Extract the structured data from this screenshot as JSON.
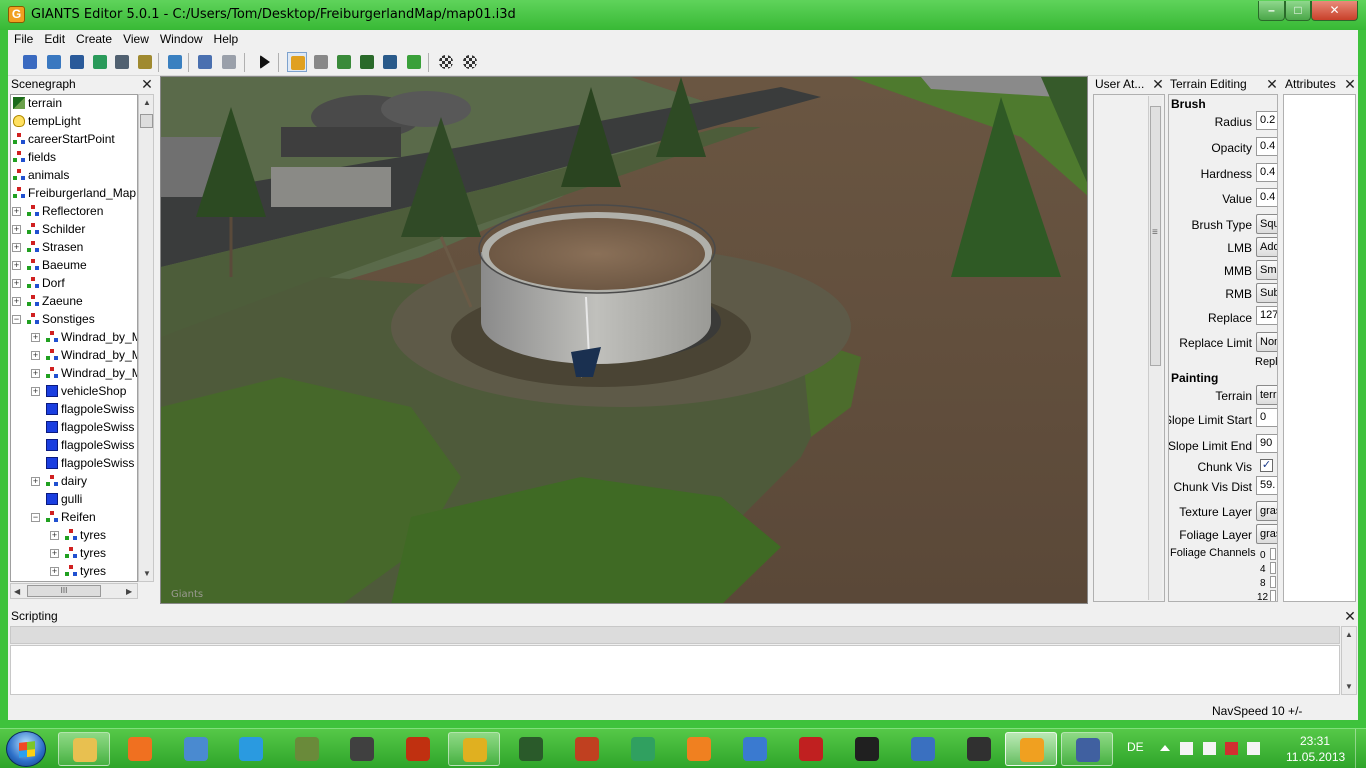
{
  "window": {
    "title": "GIANTS Editor 5.0.1 - C:/Users/Tom/Desktop/FreiburgerlandMap/map01.i3d",
    "icon_letter": "G",
    "min_label": "–",
    "max_label": "□",
    "close_label": "✕"
  },
  "menu": [
    "File",
    "Edit",
    "Create",
    "View",
    "Window",
    "Help"
  ],
  "toolbar_icons": [
    "new-icon",
    "open-icon",
    "list-icon",
    "refresh-icon",
    "save-icon",
    "save-as-icon",
    "import-icon",
    "undo-icon",
    "redo-icon",
    "play-icon",
    "home-icon",
    "magnet-icon",
    "terrain-raise-icon",
    "terrain-smooth-icon",
    "terrain-paint-icon",
    "foliage-icon",
    "checker-icon",
    "checker-search-icon"
  ],
  "scenegraph": {
    "title": "Scenegraph",
    "close": "✕",
    "items": [
      {
        "label": "terrain",
        "icon": "terrain-icon",
        "depth": 0,
        "expander": ""
      },
      {
        "label": "tempLight",
        "icon": "light-icon",
        "depth": 0,
        "expander": ""
      },
      {
        "label": "careerStartPoint",
        "icon": "transformgroup-icon",
        "depth": 0,
        "expander": ""
      },
      {
        "label": "fields",
        "icon": "transformgroup-icon",
        "depth": 0,
        "expander": ""
      },
      {
        "label": "animals",
        "icon": "transformgroup-icon",
        "depth": 0,
        "expander": ""
      },
      {
        "label": "Freiburgerland_Map",
        "icon": "transformgroup-icon",
        "depth": 0,
        "expander": ""
      },
      {
        "label": "Reflectoren",
        "icon": "transformgroup-icon",
        "depth": 1,
        "expander": "+"
      },
      {
        "label": "Schilder",
        "icon": "transformgroup-icon",
        "depth": 1,
        "expander": "+"
      },
      {
        "label": "Strasen",
        "icon": "transformgroup-icon",
        "depth": 1,
        "expander": "+"
      },
      {
        "label": "Baeume",
        "icon": "transformgroup-icon",
        "depth": 1,
        "expander": "+"
      },
      {
        "label": "Dorf",
        "icon": "transformgroup-icon",
        "depth": 1,
        "expander": "+"
      },
      {
        "label": "Zaeune",
        "icon": "transformgroup-icon",
        "depth": 1,
        "expander": "+"
      },
      {
        "label": "Sonstiges",
        "icon": "transformgroup-icon",
        "depth": 1,
        "expander": "−"
      },
      {
        "label": "Windrad_by_M",
        "icon": "transformgroup-icon",
        "depth": 2,
        "expander": "+"
      },
      {
        "label": "Windrad_by_M",
        "icon": "transformgroup-icon",
        "depth": 2,
        "expander": "+"
      },
      {
        "label": "Windrad_by_M",
        "icon": "transformgroup-icon",
        "depth": 2,
        "expander": "+"
      },
      {
        "label": "vehicleShop",
        "icon": "shape-icon",
        "depth": 2,
        "expander": "+"
      },
      {
        "label": "flagpoleSwiss",
        "icon": "shape-icon",
        "depth": 2,
        "expander": ""
      },
      {
        "label": "flagpoleSwiss",
        "icon": "shape-icon",
        "depth": 2,
        "expander": ""
      },
      {
        "label": "flagpoleSwiss",
        "icon": "shape-icon",
        "depth": 2,
        "expander": ""
      },
      {
        "label": "flagpoleSwiss",
        "icon": "shape-icon",
        "depth": 2,
        "expander": ""
      },
      {
        "label": "dairy",
        "icon": "transformgroup-icon",
        "depth": 2,
        "expander": "+"
      },
      {
        "label": "gulli",
        "icon": "shape-icon",
        "depth": 2,
        "expander": ""
      },
      {
        "label": "Reifen",
        "icon": "transformgroup-icon",
        "depth": 2,
        "expander": "−"
      },
      {
        "label": "tyres",
        "icon": "transformgroup-icon",
        "depth": 3,
        "expander": "+"
      },
      {
        "label": "tyres",
        "icon": "transformgroup-icon",
        "depth": 3,
        "expander": "+"
      },
      {
        "label": "tyres",
        "icon": "transformgroup-icon",
        "depth": 3,
        "expander": "+"
      }
    ]
  },
  "viewport": {
    "watermark": "Giants"
  },
  "user_attributes": {
    "title": "User At...",
    "close": "✕",
    "grip": "≡"
  },
  "terrain_editing": {
    "title": "Terrain Editing",
    "close": "✕",
    "brush_heading": "Brush",
    "painting_heading": "Painting",
    "fields": {
      "radius": {
        "label": "Radius",
        "value": "0.2"
      },
      "opacity": {
        "label": "Opacity",
        "value": "0.4"
      },
      "hardness": {
        "label": "Hardness",
        "value": "0.4"
      },
      "value": {
        "label": "Value",
        "value": "0.4"
      },
      "brush_type": {
        "label": "Brush Type",
        "value": "Squ"
      },
      "lmb": {
        "label": "LMB",
        "value": "Add"
      },
      "mmb": {
        "label": "MMB",
        "value": "Smo"
      },
      "rmb": {
        "label": "RMB",
        "value": "Sub"
      },
      "replace": {
        "label": "Replace",
        "value": "127"
      },
      "replace_limit": {
        "label": "Replace Limit",
        "value": "Non"
      },
      "replace_note": "Repla",
      "terrain": {
        "label": "Terrain",
        "value": "terr"
      },
      "slope_limit_start": {
        "label": "Slope Limit Start",
        "value": "0"
      },
      "slope_limit_end": {
        "label": "Slope Limit End",
        "value": "90"
      },
      "chunk_vis": {
        "label": "Chunk Vis",
        "value": "✓"
      },
      "chunk_vis_dist": {
        "label": "Chunk Vis Dist",
        "value": "59."
      },
      "texture_layer": {
        "label": "Texture Layer",
        "value": "gras"
      },
      "foliage_layer": {
        "label": "Foliage Layer",
        "value": "gras"
      },
      "foliage_channels": {
        "label": "Foliage Channels",
        "values": [
          "0",
          "4",
          "8",
          "12"
        ]
      }
    }
  },
  "attributes": {
    "title": "Attributes",
    "close": "✕"
  },
  "scripting": {
    "title": "Scripting",
    "close": "✕"
  },
  "statusbar": {
    "navspeed": "NavSpeed 10 +/-"
  },
  "taskbar": {
    "apps": [
      {
        "name": "explorer-icon",
        "color": "#e8c050",
        "state": "open"
      },
      {
        "name": "media-player-icon",
        "color": "#f07020",
        "state": ""
      },
      {
        "name": "paint-icon",
        "color": "#4a8ad0",
        "state": ""
      },
      {
        "name": "internet-explorer-icon",
        "color": "#2a9ae0",
        "state": ""
      },
      {
        "name": "minecraft-icon",
        "color": "#6a8a3a",
        "state": ""
      },
      {
        "name": "game99-icon",
        "color": "#404040",
        "state": ""
      },
      {
        "name": "em2012-icon",
        "color": "#c03010",
        "state": ""
      },
      {
        "name": "chrome-icon",
        "color": "#e0b020",
        "state": "open"
      },
      {
        "name": "tractor-icon",
        "color": "#2a5a2a",
        "state": ""
      },
      {
        "name": "farming-simulator-icon",
        "color": "#c04020",
        "state": ""
      },
      {
        "name": "audio-icon",
        "color": "#30a060",
        "state": ""
      },
      {
        "name": "blender-icon",
        "color": "#f08020",
        "state": ""
      },
      {
        "name": "game-duck-icon",
        "color": "#3a7ad0",
        "state": ""
      },
      {
        "name": "red-tractor-icon",
        "color": "#c02020",
        "state": ""
      },
      {
        "name": "game-2-icon",
        "color": "#202020",
        "state": ""
      },
      {
        "name": "messenger-icon",
        "color": "#3a70c0",
        "state": ""
      },
      {
        "name": "pen-tool-icon",
        "color": "#303030",
        "state": ""
      },
      {
        "name": "giants-editor-icon",
        "color": "#f0a020",
        "state": "active"
      },
      {
        "name": "screenshot-tool-icon",
        "color": "#4060a0",
        "state": "open"
      }
    ],
    "language": "DE",
    "tray_icons": [
      "show-hidden-icon",
      "network-device-icon",
      "signal-icon",
      "flag-alert-icon",
      "volume-icon"
    ],
    "time": "23:31",
    "date": "11.05.2013"
  }
}
